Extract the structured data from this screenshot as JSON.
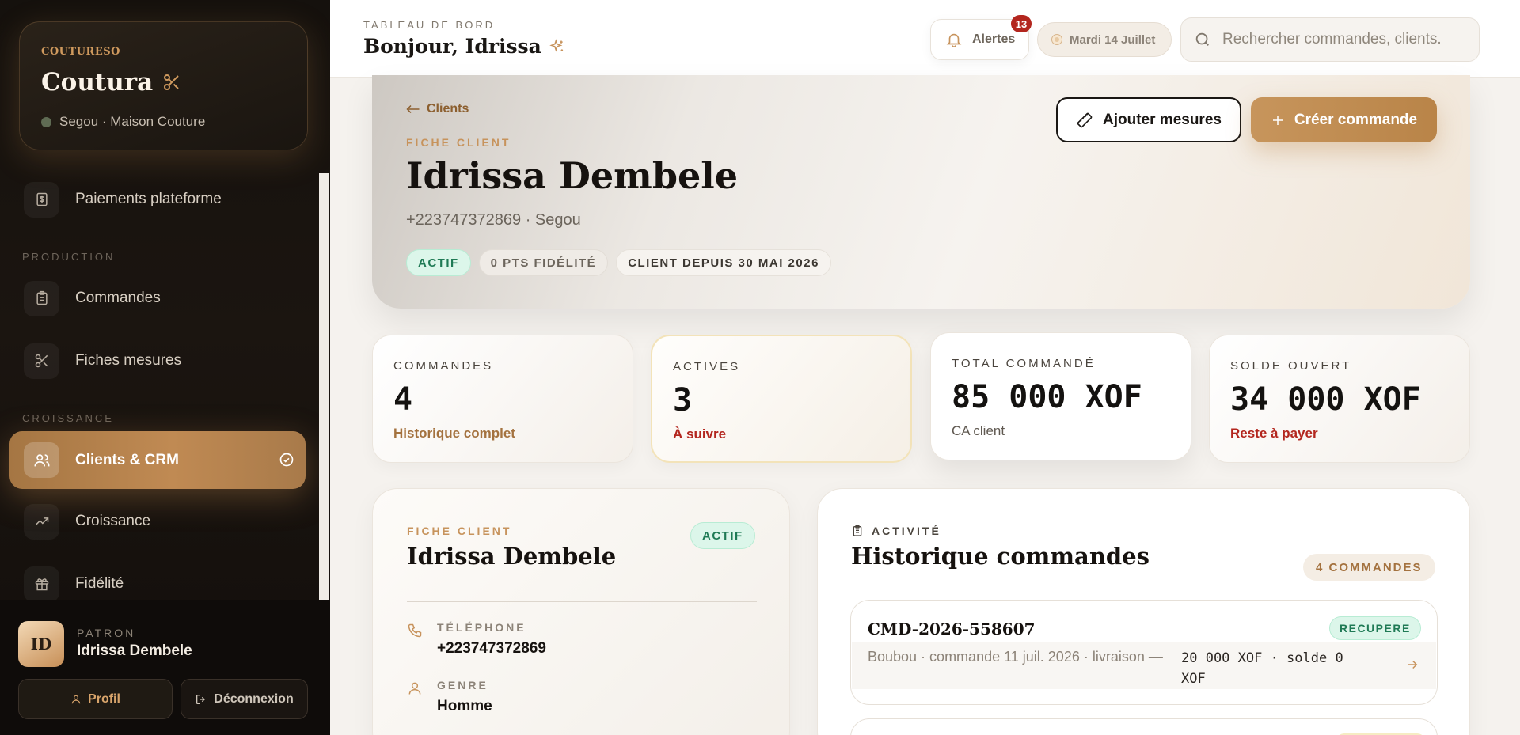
{
  "brand": {
    "kicker": "COUTURESO",
    "name": "Coutura",
    "location": "Segou · Maison Couture"
  },
  "sidebar": {
    "items": [
      {
        "label": "Paiements plateforme",
        "icon": "dollar-file-icon"
      },
      {
        "label": "Commandes",
        "icon": "clipboard-icon"
      },
      {
        "label": "Fiches mesures",
        "icon": "scissors-icon"
      },
      {
        "label": "Clients & CRM",
        "icon": "users-icon",
        "active": true
      },
      {
        "label": "Croissance",
        "icon": "trend-icon"
      },
      {
        "label": "Fidélité",
        "icon": "gift-icon"
      }
    ],
    "sections": {
      "production": "PRODUCTION",
      "growth": "CROISSANCE"
    }
  },
  "user": {
    "initials": "ID",
    "role": "PATRON",
    "name": "Idrissa Dembele",
    "profile_label": "Profil",
    "logout_label": "Déconnexion"
  },
  "topbar": {
    "kicker": "TABLEAU DE BORD",
    "greeting": "Bonjour, Idrissa",
    "alerts_label": "Alertes",
    "alerts_count": "13",
    "date": "Mardi 14 Juillet",
    "search_placeholder": "Rechercher commandes, clients."
  },
  "hero": {
    "back_label": "Clients",
    "kicker": "FICHE CLIENT",
    "name": "Idrissa Dembele",
    "subtitle": "+223747372869 · Segou",
    "pills": [
      "ACTIF",
      "0 PTS FIDÉLITÉ",
      "CLIENT DEPUIS 30 MAI 2026"
    ],
    "add_measures_label": "Ajouter mesures",
    "create_order_label": "Créer commande"
  },
  "stats": [
    {
      "label": "COMMANDES",
      "value": "4",
      "note": "Historique complet"
    },
    {
      "label": "ACTIVES",
      "value": "3",
      "note": "À suivre"
    },
    {
      "label": "TOTAL COMMANDÉ",
      "value": "85 000 XOF",
      "note": "CA client"
    },
    {
      "label": "SOLDE OUVERT",
      "value": "34 000 XOF",
      "note": "Reste à payer"
    }
  ],
  "client_card": {
    "kicker": "FICHE CLIENT",
    "name": "Idrissa Dembele",
    "status": "ACTIF",
    "fields": [
      {
        "label": "TÉLÉPHONE",
        "value": "+223747372869"
      },
      {
        "label": "GENRE",
        "value": "Homme"
      }
    ]
  },
  "activity": {
    "kicker": "ACTIVITÉ",
    "title": "Historique commandes",
    "count": "4 COMMANDES",
    "orders": [
      {
        "id": "CMD-2026-558607",
        "status": "RECUPERE",
        "meta": "Boubou · commande 11 juil. 2026 · livraison —",
        "amount": "20 000 XOF · solde 0 XOF"
      }
    ]
  },
  "colors": {
    "accent": "#c7935c",
    "sidebar_bg": "#15110d",
    "success": "#1f7a55",
    "danger": "#b3261e"
  }
}
